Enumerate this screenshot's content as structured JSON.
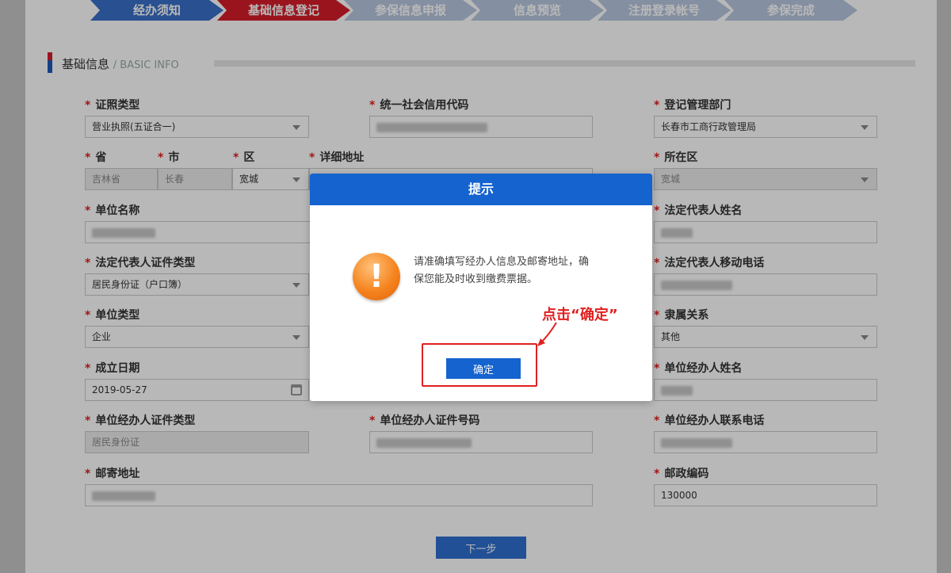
{
  "steps": [
    "经办须知",
    "基础信息登记",
    "参保信息申报",
    "信息预览",
    "注册登录帐号",
    "参保完成"
  ],
  "active_step": 1,
  "section": {
    "title": "基础信息",
    "subtitle": "/ BASIC INFO"
  },
  "fields": {
    "license_type": {
      "label": "证照类型",
      "value": "营业执照(五证合一)"
    },
    "credit_code": {
      "label": "统一社会信用代码",
      "value": ""
    },
    "reg_dept": {
      "label": "登记管理部门",
      "value": "长春市工商行政管理局"
    },
    "province": {
      "label": "省",
      "value": "吉林省"
    },
    "city": {
      "label": "市",
      "value": "长春"
    },
    "district": {
      "label": "区",
      "value": "宽城"
    },
    "address": {
      "label": "详细地址",
      "value": ""
    },
    "location_district": {
      "label": "所在区",
      "value": "宽城"
    },
    "unit_name": {
      "label": "单位名称",
      "value": ""
    },
    "legal_rep_name": {
      "label": "法定代表人姓名",
      "value": ""
    },
    "legal_rep_id_type": {
      "label": "法定代表人证件类型",
      "value": "居民身份证（户口簿）"
    },
    "legal_rep_phone": {
      "label": "法定代表人移动电话",
      "value": ""
    },
    "unit_type": {
      "label": "单位类型",
      "value": "企业"
    },
    "affiliation": {
      "label": "隶属关系",
      "value": "其他"
    },
    "founding_date": {
      "label": "成立日期",
      "value": "2019-05-27"
    },
    "agent_name": {
      "label": "单位经办人姓名",
      "value": ""
    },
    "agent_id_type": {
      "label": "单位经办人证件类型",
      "value": "居民身份证"
    },
    "agent_id_no": {
      "label": "单位经办人证件号码",
      "value": ""
    },
    "agent_phone": {
      "label": "单位经办人联系电话",
      "value": ""
    },
    "mailing_address": {
      "label": "邮寄地址",
      "value": ""
    },
    "postal_code": {
      "label": "邮政编码",
      "value": "130000"
    }
  },
  "next_button": "下一步",
  "dialog": {
    "title": "提示",
    "icon": "exclamation-warning-icon",
    "message": "请准确填写经办人信息及邮寄地址，确保您能及时收到缴费票据。",
    "ok_label": "确定"
  },
  "annotation": "点击“确定”",
  "colors": {
    "primary": "#1463cf",
    "active_step": "#d61c2a",
    "annotation": "#e02020"
  }
}
